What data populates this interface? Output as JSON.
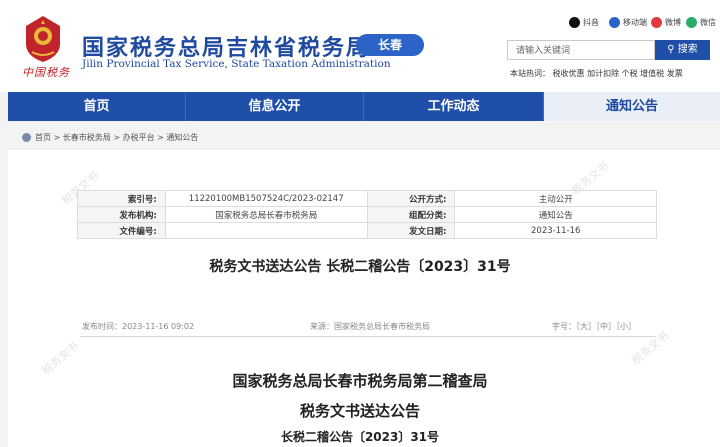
{
  "header": {
    "site_title": "国家税务总局吉林省税务局",
    "site_subtitle": "Jilin Provincial Tax Service, State Taxation Administration",
    "city_badge": "长春",
    "logo_text": "中国税务",
    "social": {
      "douyin": "抖音",
      "mobile": "移动端",
      "weibo": "微博",
      "wechat": "微信"
    },
    "search": {
      "placeholder": "请输入关键词",
      "button_label": "搜索"
    },
    "hot_words": "本站热词：  税收优惠  加计扣除  个税  增值税  发票"
  },
  "nav": {
    "items": [
      {
        "label": "首页"
      },
      {
        "label": "信息公开"
      },
      {
        "label": "工作动态"
      },
      {
        "label": "通知公告"
      }
    ]
  },
  "breadcrumb": {
    "text": "首页 > 长春市税务局 > 办税平台 > 通知公告"
  },
  "meta": {
    "rows": [
      {
        "l1": "索引号:",
        "v1": "11220100MB1507524C/2023-02147",
        "l2": "公开方式:",
        "v2": "主动公开"
      },
      {
        "l1": "发布机构:",
        "v1": "国家税务总局长春市税务局",
        "l2": "组配分类:",
        "v2": "通知公告"
      },
      {
        "l1": "文件编号:",
        "v1": "",
        "l2": "发文日期:",
        "v2": "2023-11-16"
      }
    ]
  },
  "article": {
    "title": "税务文书送达公告 长税二稽公告〔2023〕31号",
    "publish_time": "发布时间：2023-11-16 09:02",
    "source": "来源：国家税务总局长春市税务局",
    "font_size": "字号：［大］［中］［小］"
  },
  "document": {
    "line1": "国家税务总局长春市税务局第二稽查局",
    "line2": "税务文书送达公告",
    "line3": "长税二稽公告〔2023〕31号"
  },
  "colors": {
    "brand_blue": "#1f4fa8",
    "logo_red": "#c0232a"
  }
}
